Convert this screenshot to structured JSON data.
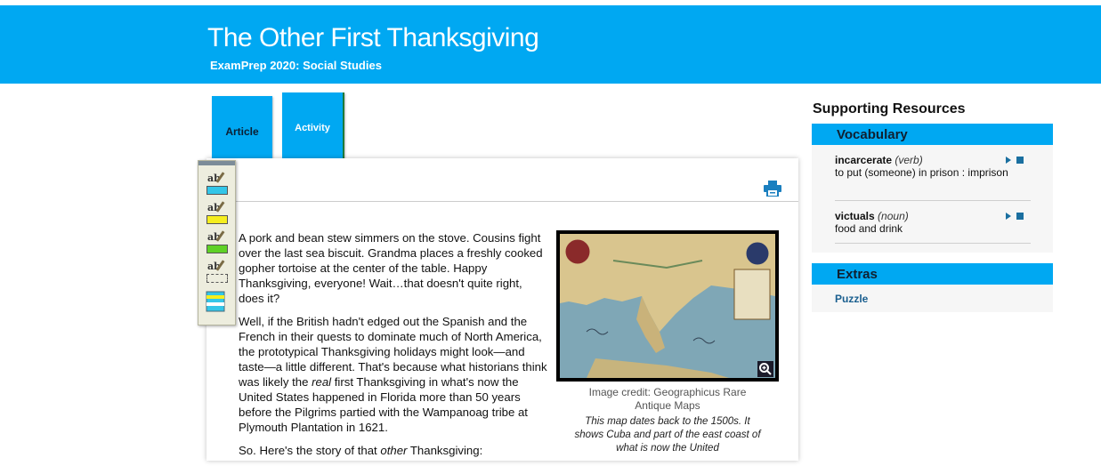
{
  "header": {
    "title": "The Other First Thanksgiving",
    "subtitle": "ExamPrep 2020: Social Studies"
  },
  "tabs": [
    {
      "label": "Article"
    },
    {
      "label": "Activity"
    }
  ],
  "toolbox": {
    "tools": [
      {
        "icon": "highlight-blue-icon",
        "color": "#33c6e8"
      },
      {
        "icon": "highlight-yellow-icon",
        "color": "#f5ee1e"
      },
      {
        "icon": "highlight-green-icon",
        "color": "#5fd126"
      },
      {
        "icon": "highlight-erase-icon",
        "color": "#ededde"
      },
      {
        "icon": "notes-icon",
        "color": "#33c6e8"
      }
    ]
  },
  "article": {
    "paragraphs": [
      "A pork and bean stew simmers on the stove. Cousins fight over the last sea biscuit. Grandma places a freshly cooked gopher tortoise at the center of the table. Happy Thanksgiving, everyone! Wait…that doesn't quite right, does it?",
      "Well, if the British hadn't edged out the Spanish and the French in their quests to dominate much of North America, the prototypical Thanksgiving holidays might look—and taste—a little different. That's because what historians think was likely the ",
      "real",
      " first Thanksgiving in what's now the United States happened in Florida more than 50 years before the Pilgrims partied with the Wampanoag tribe at Plymouth Plantation in 1621.",
      "So. Here's the story of that ",
      "other",
      " Thanksgiving:"
    ],
    "image_credit": "Image credit: Geographicus Rare Antique Maps",
    "image_caption": "This map dates back to the 1500s. It shows Cuba and part of the east coast of what is now the United"
  },
  "sidebar": {
    "title": "Supporting Resources",
    "vocabulary": {
      "heading": "Vocabulary",
      "items": [
        {
          "word": "incarcerate",
          "pos": "(verb)",
          "definition": "to put (someone) in prison : imprison"
        },
        {
          "word": "victuals",
          "pos": "(noun)",
          "definition": "food and drink"
        }
      ]
    },
    "extras": {
      "heading": "Extras",
      "link": "Puzzle"
    }
  },
  "colors": {
    "accent": "#00a8f2",
    "link": "#1a5f8f"
  }
}
